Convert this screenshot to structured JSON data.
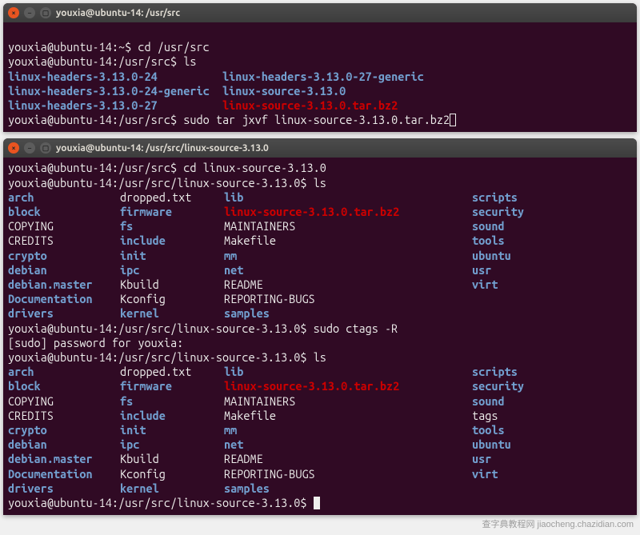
{
  "window1": {
    "title": "youxia@ubuntu-14: /usr/src",
    "lines": {
      "p1_prompt": "youxia@ubuntu-14:~$ ",
      "p1_cmd": "cd /usr/src",
      "p2_prompt": "youxia@ubuntu-14:/usr/src$ ",
      "p2_cmd": "ls",
      "ls_row1_c1": "linux-headers-3.13.0-24",
      "ls_row1_c2": "linux-headers-3.13.0-27-generic",
      "ls_row2_c1": "linux-headers-3.13.0-24-generic",
      "ls_row2_c2": "linux-source-3.13.0",
      "ls_row3_c1": "linux-headers-3.13.0-27",
      "ls_row3_c2": "linux-source-3.13.0.tar.bz2",
      "p3_prompt": "youxia@ubuntu-14:/usr/src$ ",
      "p3_cmd": "sudo tar jxvf linux-source-3.13.0.tar.bz2"
    }
  },
  "window2": {
    "title": "youxia@ubuntu-14: /usr/src/linux-source-3.13.0",
    "lines": {
      "p1_prompt": "youxia@ubuntu-14:/usr/src$ ",
      "p1_cmd": "cd linux-source-3.13.0",
      "p2_prompt": "youxia@ubuntu-14:/usr/src/linux-source-3.13.0$ ",
      "p2_cmd": "ls",
      "p3_prompt": "youxia@ubuntu-14:/usr/src/linux-source-3.13.0$ ",
      "p3_cmd": "sudo ctags -R",
      "sudo_pw": "[sudo] password for youxia:",
      "p4_prompt": "youxia@ubuntu-14:/usr/src/linux-source-3.13.0$ ",
      "p4_cmd": "ls",
      "p5_prompt": "youxia@ubuntu-14:/usr/src/linux-source-3.13.0$ "
    },
    "ls1": {
      "c1": [
        "arch",
        "block",
        "COPYING",
        "CREDITS",
        "crypto",
        "debian",
        "debian.master",
        "Documentation",
        "drivers"
      ],
      "c1_type": [
        "dir",
        "dir",
        "file",
        "file",
        "dir",
        "dir",
        "dir",
        "dir",
        "dir"
      ],
      "c2": [
        "dropped.txt",
        "firmware",
        "fs",
        "include",
        "init",
        "ipc",
        "Kbuild",
        "Kconfig",
        "kernel"
      ],
      "c2_type": [
        "file",
        "dir",
        "dir",
        "dir",
        "dir",
        "dir",
        "file",
        "file",
        "dir"
      ],
      "c3": [
        "lib",
        "linux-source-3.13.0.tar.bz2",
        "MAINTAINERS",
        "Makefile",
        "mm",
        "net",
        "README",
        "REPORTING-BUGS",
        "samples"
      ],
      "c3_type": [
        "dir",
        "archive",
        "file",
        "file",
        "dir",
        "dir",
        "file",
        "file",
        "dir"
      ],
      "c4": [
        "scripts",
        "security",
        "sound",
        "tools",
        "ubuntu",
        "usr",
        "virt",
        "",
        ""
      ],
      "c4_type": [
        "dir",
        "dir",
        "dir",
        "dir",
        "dir",
        "dir",
        "dir",
        "",
        ""
      ]
    },
    "ls2": {
      "c1": [
        "arch",
        "block",
        "COPYING",
        "CREDITS",
        "crypto",
        "debian",
        "debian.master",
        "Documentation",
        "drivers"
      ],
      "c1_type": [
        "dir",
        "dir",
        "file",
        "file",
        "dir",
        "dir",
        "dir",
        "dir",
        "dir"
      ],
      "c2": [
        "dropped.txt",
        "firmware",
        "fs",
        "include",
        "init",
        "ipc",
        "Kbuild",
        "Kconfig",
        "kernel"
      ],
      "c2_type": [
        "file",
        "dir",
        "dir",
        "dir",
        "dir",
        "dir",
        "file",
        "file",
        "dir"
      ],
      "c3": [
        "lib",
        "linux-source-3.13.0.tar.bz2",
        "MAINTAINERS",
        "Makefile",
        "mm",
        "net",
        "README",
        "REPORTING-BUGS",
        "samples"
      ],
      "c3_type": [
        "dir",
        "archive",
        "file",
        "file",
        "dir",
        "dir",
        "file",
        "file",
        "dir"
      ],
      "c4": [
        "scripts",
        "security",
        "sound",
        "tags",
        "tools",
        "ubuntu",
        "usr",
        "virt",
        ""
      ],
      "c4_type": [
        "dir",
        "dir",
        "dir",
        "file",
        "dir",
        "dir",
        "dir",
        "dir",
        ""
      ]
    }
  },
  "watermark": "查字典教程网  jiaocheng.chazidian.com"
}
